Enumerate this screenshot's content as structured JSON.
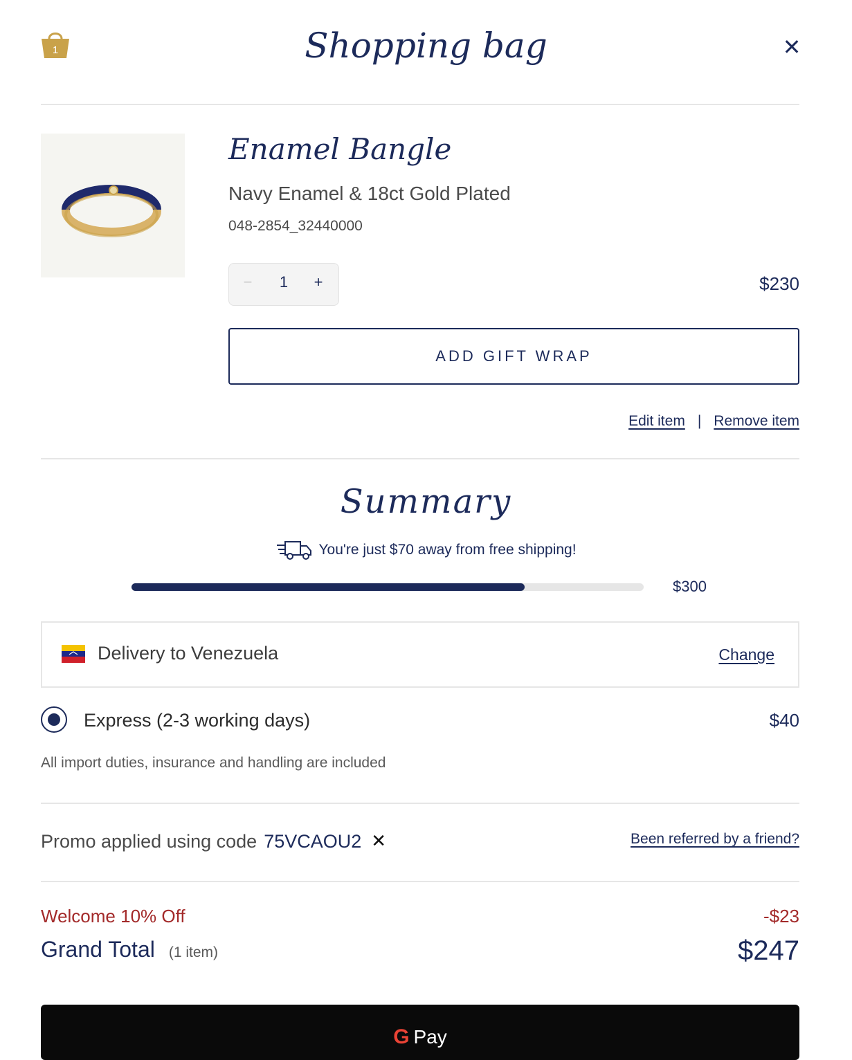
{
  "header": {
    "title": "Shopping bag",
    "bag_icon": "shopping-bag-icon",
    "bag_count": "1",
    "close_icon": "close-icon",
    "close_glyph": "✕"
  },
  "item": {
    "name": "Enamel Bangle",
    "variant": "Navy Enamel & 18ct Gold Plated",
    "sku": "048-2854_32440000",
    "quantity": "1",
    "decrement_glyph": "−",
    "increment_glyph": "+",
    "price": "$230",
    "gift_wrap_label": "ADD GIFT WRAP",
    "edit_label": "Edit item",
    "separator": "|",
    "remove_label": "Remove item"
  },
  "summary": {
    "title": "Summary",
    "shipping_icon": "delivery-truck-icon",
    "shipping_message": "You're just $70 away from free shipping!",
    "progress_fraction": 0.767,
    "threshold": "$300"
  },
  "delivery": {
    "flag_icon": "venezuela-flag-icon",
    "label": "Delivery to Venezuela",
    "change_label": "Change",
    "option_label": "Express (2-3 working days)",
    "option_price": "$40",
    "option_selected": true,
    "duties_note": "All import duties, insurance and handling are included"
  },
  "promo": {
    "prefix": "Promo applied using code",
    "code": "75VCAOU2",
    "remove_glyph": "✕",
    "referral_label": "Been referred by a friend?"
  },
  "totals": {
    "discount_label": "Welcome 10% Off",
    "discount_value": "-$23",
    "grand_total_label": "Grand Total",
    "item_count": "(1 item)",
    "grand_total_value": "$247"
  },
  "pay": {
    "gpay_label": "Pay"
  },
  "colors": {
    "navy": "#1c2a5a",
    "gold": "#c9a24a",
    "discount_red": "#a32a2a",
    "progress_track": "#e6e6e6"
  }
}
